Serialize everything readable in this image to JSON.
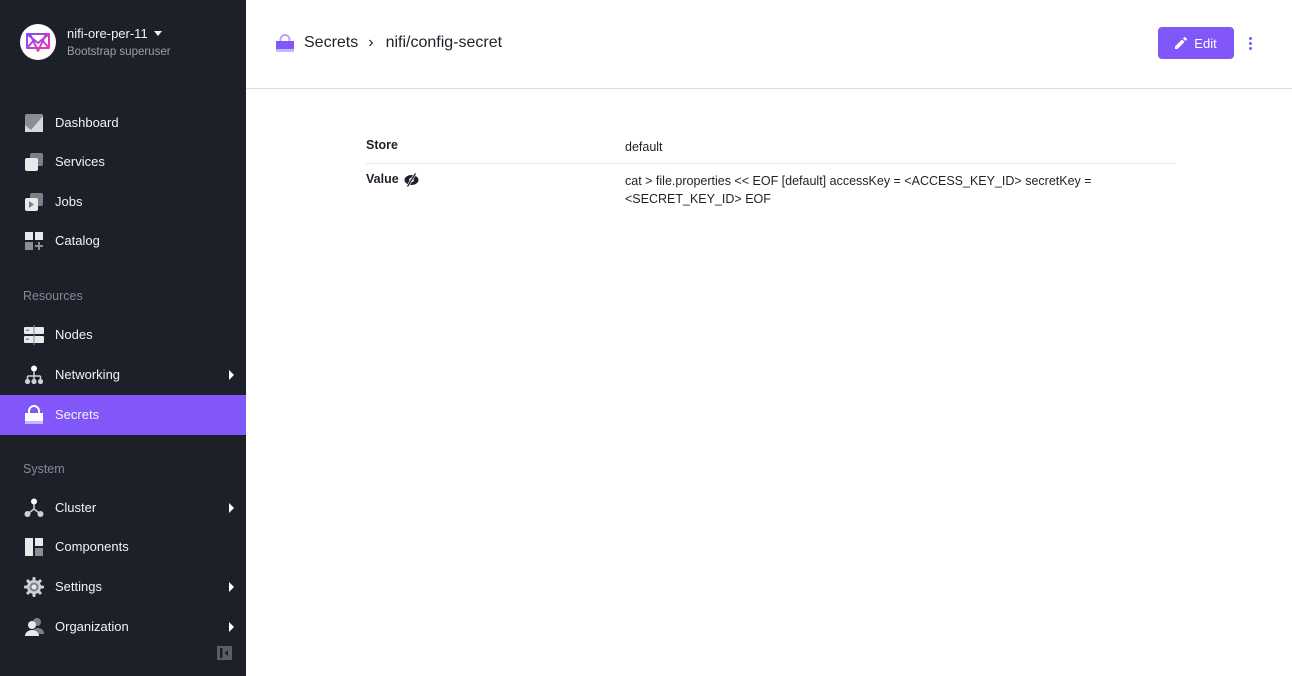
{
  "org": {
    "name": "nifi-ore-per-11",
    "role": "Bootstrap superuser",
    "logo_icon": "envelope-logo-icon"
  },
  "sidebar": {
    "items": [
      {
        "label": "Dashboard",
        "icon": "dashboard-icon"
      },
      {
        "label": "Services",
        "icon": "services-icon"
      },
      {
        "label": "Jobs",
        "icon": "jobs-icon"
      },
      {
        "label": "Catalog",
        "icon": "catalog-icon"
      }
    ],
    "sections": [
      {
        "title": "Resources",
        "items": [
          {
            "label": "Nodes",
            "icon": "nodes-icon",
            "has_submenu": false
          },
          {
            "label": "Networking",
            "icon": "networking-icon",
            "has_submenu": true
          },
          {
            "label": "Secrets",
            "icon": "lock-icon",
            "has_submenu": false,
            "active": true
          }
        ]
      },
      {
        "title": "System",
        "items": [
          {
            "label": "Cluster",
            "icon": "cluster-icon",
            "has_submenu": true
          },
          {
            "label": "Components",
            "icon": "components-icon",
            "has_submenu": false
          },
          {
            "label": "Settings",
            "icon": "gear-icon",
            "has_submenu": true
          },
          {
            "label": "Organization",
            "icon": "users-icon",
            "has_submenu": true
          }
        ]
      }
    ],
    "collapse_icon": "collapse-sidebar-icon"
  },
  "header": {
    "breadcrumb": {
      "parent": "Secrets",
      "separator": "›",
      "current": "nifi/config-secret"
    },
    "edit_label": "Edit",
    "more_icon": "more-vertical-icon"
  },
  "details": {
    "rows": [
      {
        "key": "Store",
        "value": "default"
      },
      {
        "key": "Value",
        "value": "cat > file.properties << EOF [default] accessKey = <ACCESS_KEY_ID> secretKey = <SECRET_KEY_ID> EOF",
        "icon": "eye-slash-icon"
      }
    ]
  },
  "colors": {
    "accent": "#8157fa",
    "sidebar_bg": "#1d2029"
  }
}
